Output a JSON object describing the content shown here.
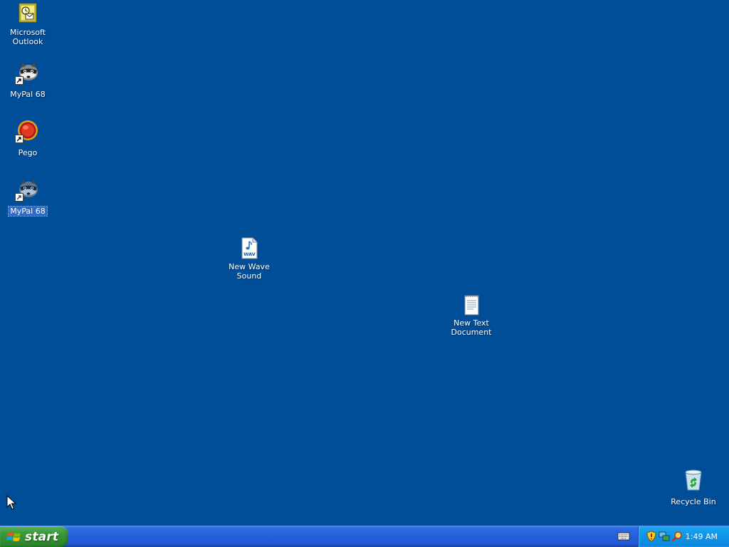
{
  "desktop": {
    "background_color": "#004e98",
    "icons": [
      {
        "label": "Microsoft Outlook",
        "icon": "outlook-icon",
        "shortcut": false,
        "selected": false
      },
      {
        "label": "MyPal 68",
        "icon": "mypal-icon",
        "shortcut": true,
        "selected": false
      },
      {
        "label": "Pego",
        "icon": "pego-icon",
        "shortcut": true,
        "selected": false
      },
      {
        "label": "MyPal 68",
        "icon": "mypal-icon",
        "shortcut": true,
        "selected": true
      },
      {
        "label": "New Wave Sound",
        "icon": "wav-file-icon",
        "shortcut": false,
        "selected": false
      },
      {
        "label": "New Text Document",
        "icon": "text-file-icon",
        "shortcut": false,
        "selected": false
      },
      {
        "label": "Recycle Bin",
        "icon": "recycle-bin-icon",
        "shortcut": false,
        "selected": false
      }
    ]
  },
  "taskbar": {
    "start_label": "start",
    "clock": "1:49 AM",
    "tray_icons": [
      "security-shield-icon",
      "network-icon",
      "search-icon"
    ],
    "lang_indicator": "keyboard-icon"
  }
}
